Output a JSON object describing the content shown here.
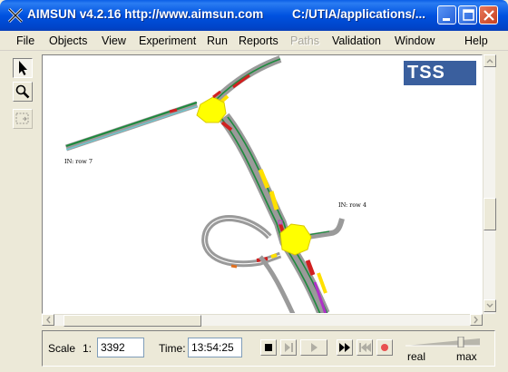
{
  "window": {
    "title": "AIMSUN v4.2.16 http://www.aimsun.com",
    "path": "C:/UTIA/applications/...",
    "brand_color": "#0a5ee6"
  },
  "menu": {
    "items": [
      {
        "label": "File",
        "enabled": true
      },
      {
        "label": "Objects",
        "enabled": true
      },
      {
        "label": "View",
        "enabled": true
      },
      {
        "label": "Experiment",
        "enabled": true
      },
      {
        "label": "Run",
        "enabled": true
      },
      {
        "label": "Reports",
        "enabled": true
      },
      {
        "label": "Paths",
        "enabled": false
      },
      {
        "label": "Validation",
        "enabled": true
      },
      {
        "label": "Window",
        "enabled": true
      },
      {
        "label": "Help",
        "enabled": true
      }
    ]
  },
  "tools": [
    {
      "icon": "arrow-pointer-icon",
      "active": true
    },
    {
      "icon": "magnifier-icon",
      "active": false
    },
    {
      "icon": "selection-rectangle-icon",
      "active": false
    }
  ],
  "canvas": {
    "logo": "TSS",
    "labels": [
      "IN: row 7",
      "IN: row 4"
    ]
  },
  "status": {
    "scale_label": "Scale",
    "scale_prefix": "1:",
    "scale_value": "3392",
    "time_label": "Time:",
    "time_value": "13:54:25",
    "speed_min_label": "real",
    "speed_max_label": "max",
    "controls": [
      "stop-icon",
      "step-icon",
      "play-icon",
      "fast-forward-icon",
      "rewind-icon",
      "record-icon"
    ]
  }
}
